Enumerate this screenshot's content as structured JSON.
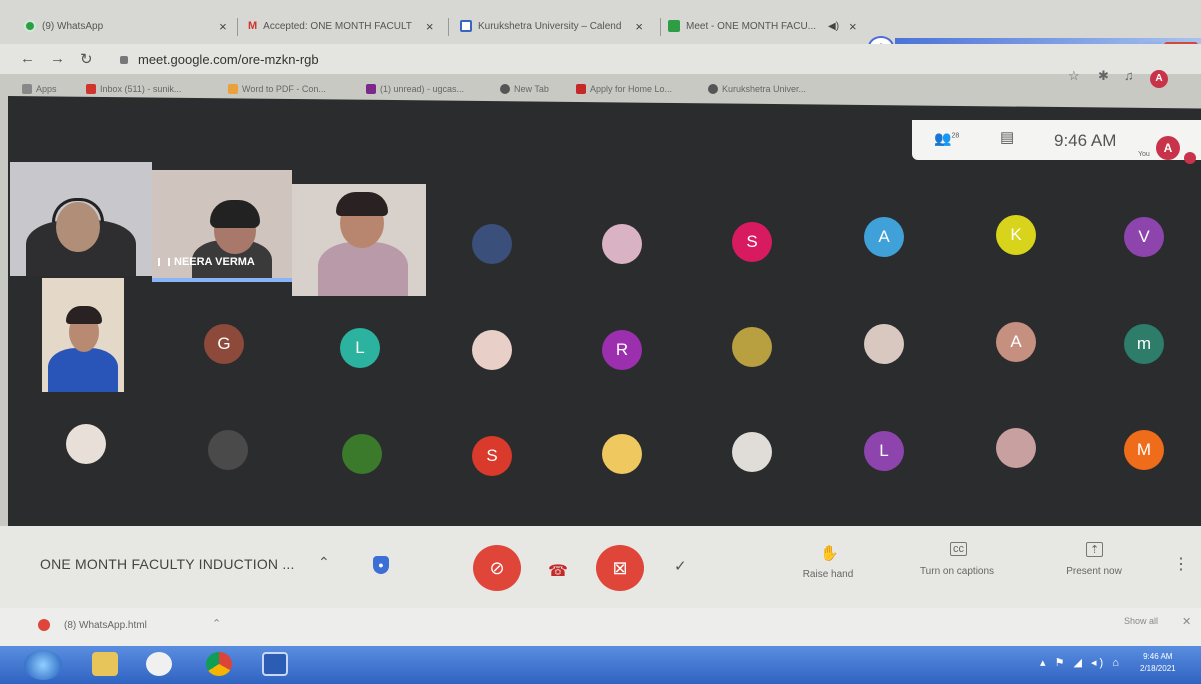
{
  "browser": {
    "tabs": [
      {
        "label": "(9) WhatsApp",
        "color": "#2e9e46"
      },
      {
        "label": "Accepted: ONE MONTH FACULT",
        "color": "#d0342c"
      },
      {
        "label": "Kurukshetra University – Calend",
        "color": "#3866c7"
      },
      {
        "label": "Meet - ONE MONTH FACU...",
        "color": "#2e9e46"
      }
    ],
    "url": "meet.google.com/ore-mzkn-rgb",
    "profile_initial": "A",
    "bookmarks": [
      {
        "label": "Apps",
        "color": "#888888"
      },
      {
        "label": "Inbox (511) - sunik...",
        "color": "#d0342c"
      },
      {
        "label": "Word to PDF - Con...",
        "color": "#e9a23b"
      },
      {
        "label": "(1) unread) - ugcas...",
        "color": "#7b2a8a"
      },
      {
        "label": "New Tab",
        "color": "#555555"
      },
      {
        "label": "Apply for Home Lo...",
        "color": "#c62828"
      },
      {
        "label": "Kurukshetra Univer...",
        "color": "#555555"
      }
    ]
  },
  "meet": {
    "participants_count": "28",
    "time": "9:46 AM",
    "you_label": "You",
    "you_initial": "A",
    "speaker_name": "NEERA VERMA",
    "tiles_row1": [
      {
        "letter": "",
        "color": "#3a4f7a",
        "photo": true
      },
      {
        "letter": "",
        "color": "#d9b3c4",
        "photo": true
      },
      {
        "letter": "S",
        "color": "#d81b60"
      },
      {
        "letter": "A",
        "color": "#3fa1d8"
      },
      {
        "letter": "K",
        "color": "#d8d41b"
      },
      {
        "letter": "V",
        "color": "#8e44ad"
      }
    ],
    "tiles_row2": [
      {
        "letter": "G",
        "color": "#8d4a3a"
      },
      {
        "letter": "L",
        "color": "#2bb3a0"
      },
      {
        "letter": "",
        "color": "#e8d0c8",
        "photo": true
      },
      {
        "letter": "R",
        "color": "#9b2fae"
      },
      {
        "letter": "",
        "color": "#b8a040",
        "photo": true
      },
      {
        "letter": "",
        "color": "#d8c8c0",
        "photo": true
      },
      {
        "letter": "A",
        "color": "#c69080"
      },
      {
        "letter": "m",
        "color": "#2e7d6a"
      }
    ],
    "tiles_row3": [
      {
        "letter": "",
        "color": "#e8e0d8",
        "photo": true
      },
      {
        "letter": "",
        "color": "#4a4a4a",
        "photo": true
      },
      {
        "letter": "",
        "color": "#3a7a2a",
        "photo": true
      },
      {
        "letter": "S",
        "color": "#d93a2b"
      },
      {
        "letter": "",
        "color": "#f0c860",
        "photo": true
      },
      {
        "letter": "",
        "color": "#e0dcd8",
        "photo": true
      },
      {
        "letter": "L",
        "color": "#8e44ad"
      },
      {
        "letter": "",
        "color": "#c8a0a0",
        "photo": true
      },
      {
        "letter": "M",
        "color": "#ef6c1a"
      }
    ],
    "meeting_title": "ONE MONTH FACULTY INDUCTION ...",
    "raise_hand": "Raise hand",
    "captions": "Turn on captions",
    "present": "Present now"
  },
  "downloads": {
    "file": "(8) WhatsApp.html",
    "show_all": "Show all"
  },
  "taskbar": {
    "time": "9:46 AM",
    "date": "2/18/2021"
  }
}
